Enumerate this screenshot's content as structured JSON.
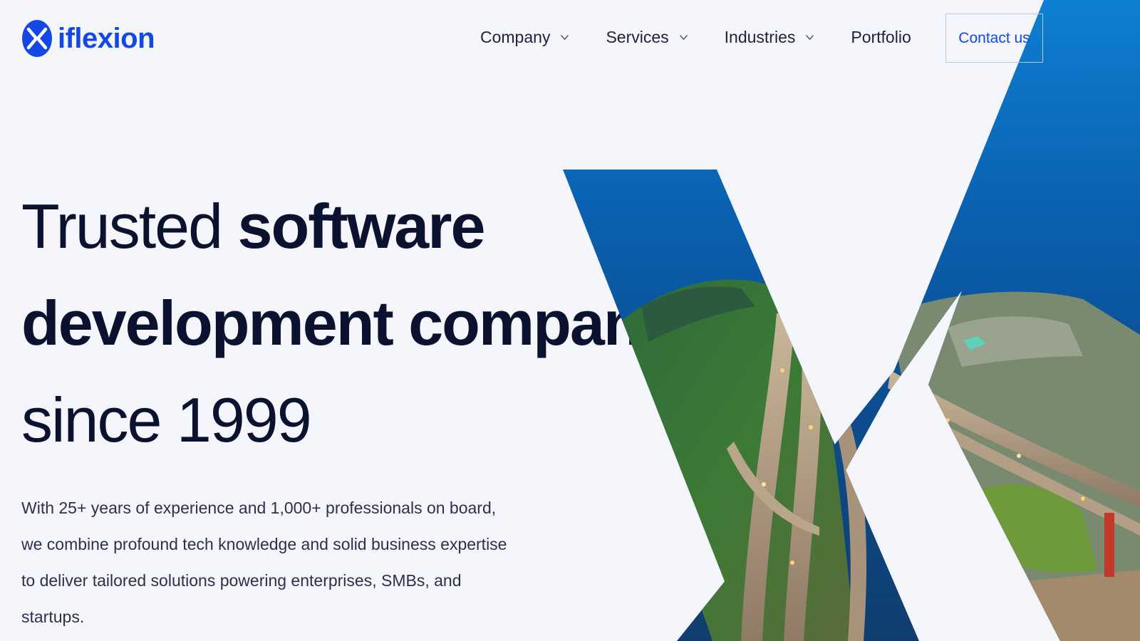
{
  "brand": {
    "name": "iflexion",
    "color": "#1448e4"
  },
  "nav": {
    "items": [
      {
        "label": "Company",
        "has_dropdown": true
      },
      {
        "label": "Services",
        "has_dropdown": true
      },
      {
        "label": "Industries",
        "has_dropdown": true
      },
      {
        "label": "Portfolio",
        "has_dropdown": false
      }
    ],
    "contact_label": "Contact us"
  },
  "hero": {
    "line1_regular": "Trusted ",
    "line1_bold": "software",
    "line2_bold": "development company",
    "line3_regular": "since 1999",
    "lead": "With 25+ years of experience and 1,000+ professionals on board, we combine profound tech knowledge and solid business expertise to deliver tailored solutions powering enterprises, SMBs, and startups.",
    "image_subject": "aerial highway interchange by the sea, clipped in an X shape"
  },
  "colors": {
    "background": "#f4f6fb",
    "heading": "#0b1230",
    "accent": "#1448e4"
  },
  "icons": {
    "logo": "iflexion-x-logo-icon",
    "dropdown": "chevron-down-icon"
  }
}
